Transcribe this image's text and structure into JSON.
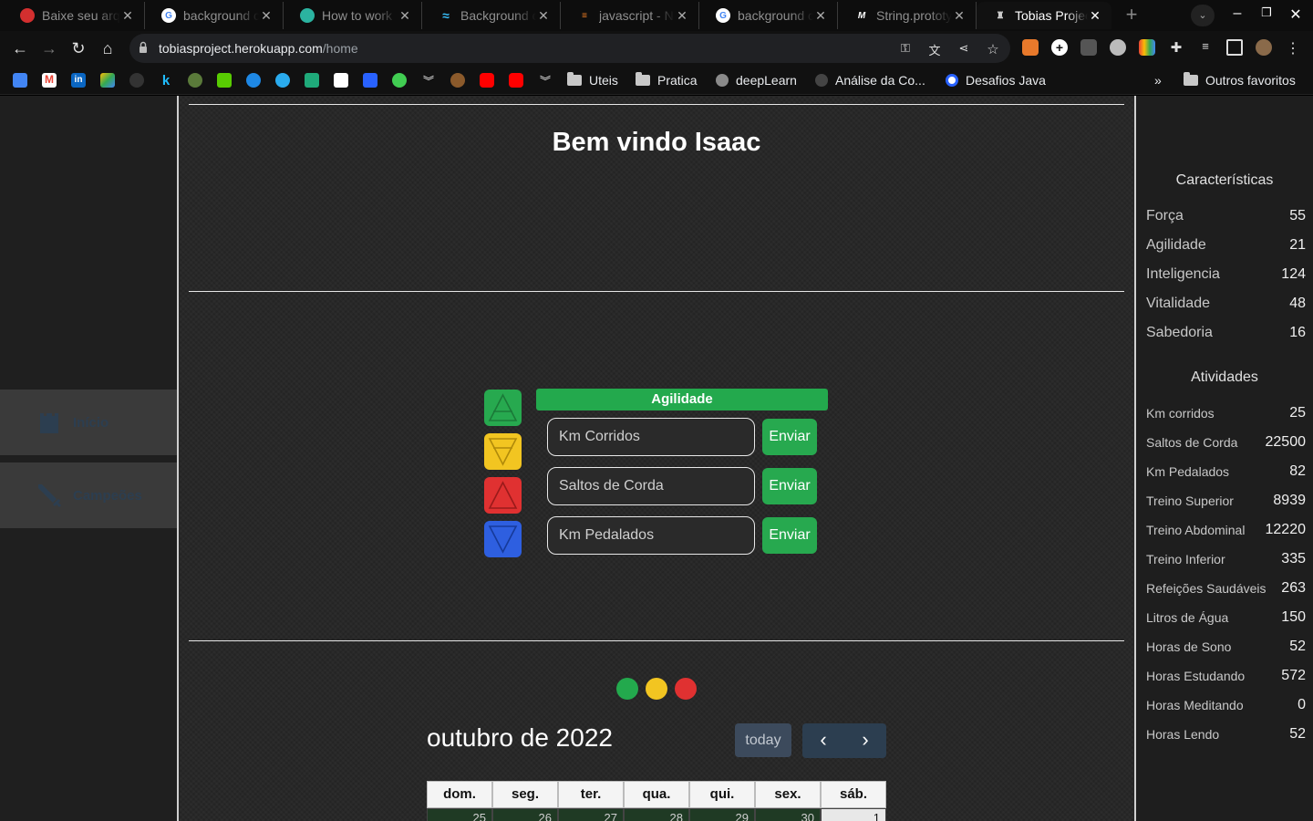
{
  "browser": {
    "tabs": [
      {
        "title": "Baixe seu arquivo",
        "favicon_color": "#d32f2f",
        "active": false
      },
      {
        "title": "background color",
        "favicon_color": "#4285f4",
        "active": false
      },
      {
        "title": "How to work",
        "favicon_color": "#2bb3a0",
        "active": false
      },
      {
        "title": "Background color",
        "favicon_color": "#38bdf8",
        "active": false
      },
      {
        "title": "javascript - N",
        "favicon_color": "#f48024",
        "active": false
      },
      {
        "title": "background color",
        "favicon_color": "#4285f4",
        "active": false
      },
      {
        "title": "String.prototype",
        "favicon_color": "#ffffff",
        "active": false
      },
      {
        "title": "Tobias Project",
        "favicon_color": "#777777",
        "active": true
      }
    ],
    "url_host": "tobiasproject.herokuapp.com",
    "url_path": "/home",
    "bookmarks": {
      "folders": [
        "Uteis",
        "Pratica",
        "deepLearn",
        "Análise da Co...",
        "Desafios Java"
      ],
      "more": "»",
      "other": "Outros favoritos"
    }
  },
  "sidebar": {
    "items": [
      {
        "label": "Início",
        "icon": "castle-icon"
      },
      {
        "label": "Campeões",
        "icon": "sword-icon"
      }
    ]
  },
  "main": {
    "welcome": "Bem vindo Isaac",
    "attribute_title": "Agilidade",
    "triangle_buttons": [
      {
        "name": "earth",
        "color": "#27a94f"
      },
      {
        "name": "air",
        "color": "#f2c521"
      },
      {
        "name": "fire",
        "color": "#e03131"
      },
      {
        "name": "water",
        "color": "#2e5fe0"
      }
    ],
    "activities": [
      {
        "placeholder": "Km Corridos",
        "button": "Enviar"
      },
      {
        "placeholder": "Saltos de Corda",
        "button": "Enviar"
      },
      {
        "placeholder": "Km Pedalados",
        "button": "Enviar"
      }
    ],
    "status_dots": [
      "#23a94d",
      "#f2c521",
      "#e03131"
    ]
  },
  "calendar": {
    "title": "outubro de 2022",
    "today_label": "today",
    "prev_icon": "chevron-left-icon",
    "next_icon": "chevron-right-icon",
    "weekdays": [
      "dom.",
      "seg.",
      "ter.",
      "qua.",
      "qui.",
      "sex.",
      "sáb."
    ],
    "first_row": [
      "25",
      "26",
      "27",
      "28",
      "29",
      "30",
      "1"
    ]
  },
  "stats": {
    "characteristics_title": "Características",
    "characteristics": [
      {
        "label": "Força",
        "value": "55"
      },
      {
        "label": "Agilidade",
        "value": "21"
      },
      {
        "label": "Inteligencia",
        "value": "124"
      },
      {
        "label": "Vitalidade",
        "value": "48"
      },
      {
        "label": "Sabedoria",
        "value": "16"
      }
    ],
    "activities_title": "Atividades",
    "activities": [
      {
        "label": "Km corridos",
        "value": "25"
      },
      {
        "label": "Saltos de Corda",
        "value": "22500"
      },
      {
        "label": "Km Pedalados",
        "value": "82"
      },
      {
        "label": "Treino Superior",
        "value": "8939"
      },
      {
        "label": "Treino Abdominal",
        "value": "12220"
      },
      {
        "label": "Treino Inferior",
        "value": "335"
      },
      {
        "label": "Refeições Saudáveis",
        "value": "263"
      },
      {
        "label": "Litros de Água",
        "value": "150"
      },
      {
        "label": "Horas de Sono",
        "value": "52"
      },
      {
        "label": "Horas Estudando",
        "value": "572"
      },
      {
        "label": "Horas Meditando",
        "value": "0"
      },
      {
        "label": "Horas Lendo",
        "value": "52"
      }
    ]
  }
}
